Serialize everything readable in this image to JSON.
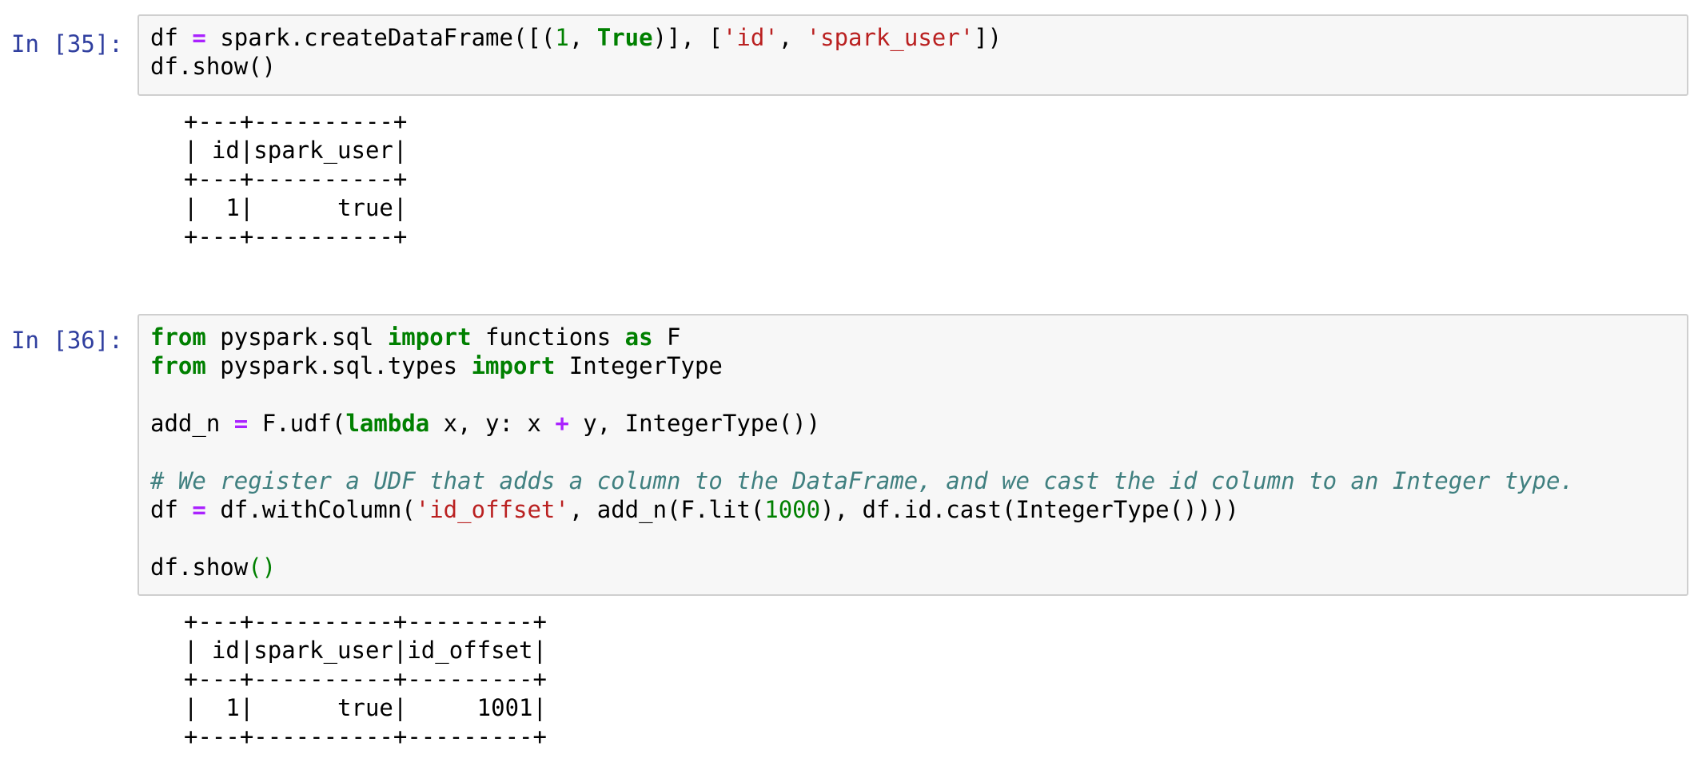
{
  "cells": [
    {
      "prompt": "In [35]:",
      "code": [
        [
          [
            "txt",
            "df "
          ],
          [
            "op",
            "="
          ],
          [
            "txt",
            " spark.createDataFrame([("
          ],
          [
            "num",
            "1"
          ],
          [
            "txt",
            ", "
          ],
          [
            "kw",
            "True"
          ],
          [
            "txt",
            ")], ["
          ],
          [
            "str",
            "'id'"
          ],
          [
            "txt",
            ", "
          ],
          [
            "str",
            "'spark_user'"
          ],
          [
            "txt",
            "])"
          ]
        ],
        [
          [
            "txt",
            "df.show()"
          ]
        ]
      ],
      "output": [
        "+---+----------+",
        "| id|spark_user|",
        "+---+----------+",
        "|  1|      true|",
        "+---+----------+"
      ]
    },
    {
      "prompt": "In [36]:",
      "code": [
        [
          [
            "kw",
            "from"
          ],
          [
            "txt",
            " pyspark.sql "
          ],
          [
            "kw",
            "import"
          ],
          [
            "txt",
            " functions "
          ],
          [
            "kw",
            "as"
          ],
          [
            "txt",
            " F"
          ]
        ],
        [
          [
            "kw",
            "from"
          ],
          [
            "txt",
            " pyspark.sql.types "
          ],
          [
            "kw",
            "import"
          ],
          [
            "txt",
            " IntegerType"
          ]
        ],
        [],
        [
          [
            "txt",
            "add_n "
          ],
          [
            "op",
            "="
          ],
          [
            "txt",
            " F.udf("
          ],
          [
            "kw",
            "lambda"
          ],
          [
            "txt",
            " x, y: x "
          ],
          [
            "op",
            "+"
          ],
          [
            "txt",
            " y, IntegerType())"
          ]
        ],
        [],
        [
          [
            "cm",
            "# We register a UDF that adds a column to the DataFrame, and we cast the id column to an Integer type."
          ]
        ],
        [
          [
            "txt",
            "df "
          ],
          [
            "op",
            "="
          ],
          [
            "txt",
            " df.withColumn("
          ],
          [
            "str",
            "'id_offset'"
          ],
          [
            "txt",
            ", add_n(F.lit("
          ],
          [
            "num",
            "1000"
          ],
          [
            "txt",
            "), df.id.cast(IntegerType())))"
          ]
        ],
        [],
        [
          [
            "txt",
            "df.show"
          ],
          [
            "pn",
            "()"
          ]
        ]
      ],
      "output": [
        "+---+----------+---------+",
        "| id|spark_user|id_offset|",
        "+---+----------+---------+",
        "|  1|      true|     1001|",
        "+---+----------+---------+"
      ]
    }
  ]
}
